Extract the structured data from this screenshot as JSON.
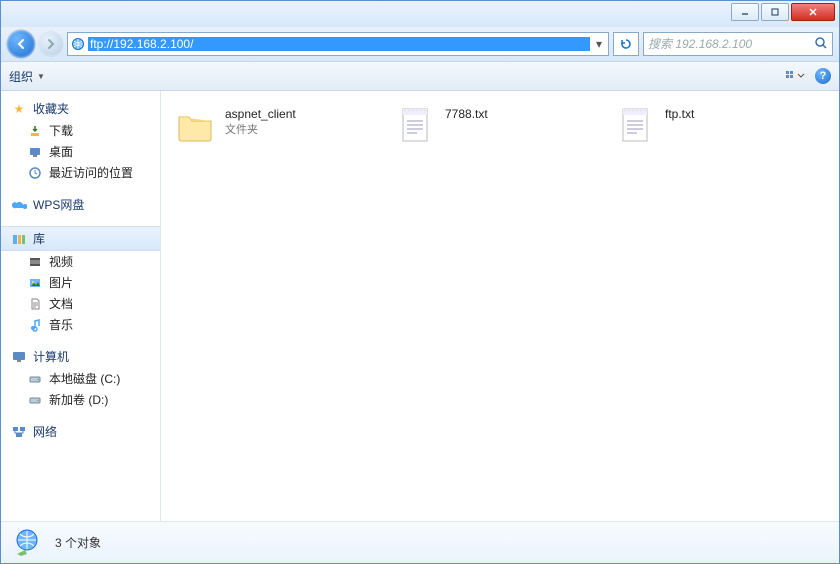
{
  "titlebar": {
    "minimize": "—",
    "maximize": "▢",
    "close": "✕"
  },
  "navbar": {
    "address": "ftp://192.168.2.100/",
    "search_placeholder": "搜索 192.168.2.100"
  },
  "toolbar": {
    "organize_label": "组织"
  },
  "sidebar": {
    "favorites": {
      "label": "收藏夹",
      "items": [
        {
          "label": "下载",
          "icon": "download-icon"
        },
        {
          "label": "桌面",
          "icon": "desktop-icon"
        },
        {
          "label": "最近访问的位置",
          "icon": "recent-icon"
        }
      ]
    },
    "wps": {
      "label": "WPS网盘"
    },
    "libraries": {
      "label": "库",
      "items": [
        {
          "label": "视频",
          "icon": "video-icon"
        },
        {
          "label": "图片",
          "icon": "picture-icon"
        },
        {
          "label": "文档",
          "icon": "document-icon"
        },
        {
          "label": "音乐",
          "icon": "music-icon"
        }
      ]
    },
    "computer": {
      "label": "计算机",
      "items": [
        {
          "label": "本地磁盘 (C:)",
          "icon": "drive-icon"
        },
        {
          "label": "新加卷 (D:)",
          "icon": "drive-icon"
        }
      ]
    },
    "network": {
      "label": "网络"
    }
  },
  "content": {
    "items": [
      {
        "name": "aspnet_client",
        "type": "folder",
        "sub": "文件夹"
      },
      {
        "name": "7788.txt",
        "type": "text"
      },
      {
        "name": "ftp.txt",
        "type": "text"
      }
    ]
  },
  "statusbar": {
    "text": "3 个对象"
  }
}
